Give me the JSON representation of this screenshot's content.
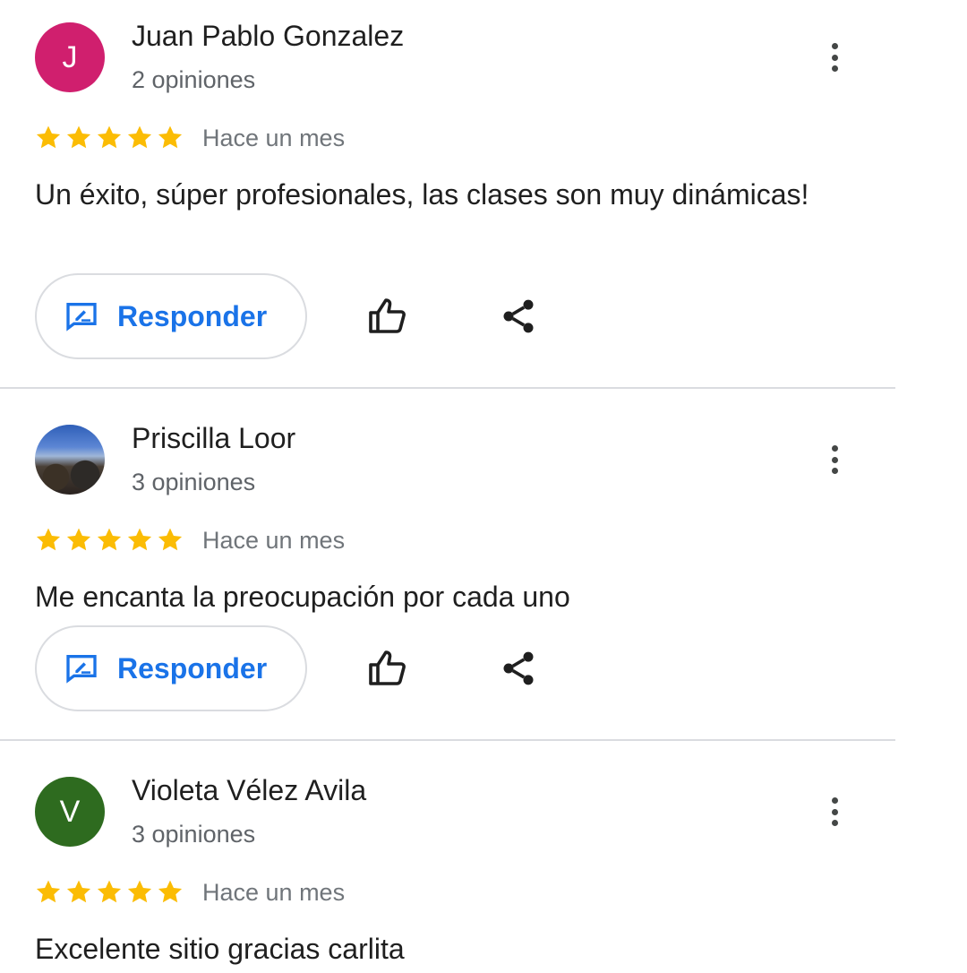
{
  "reviews": [
    {
      "avatar_letter": "J",
      "avatar_color": "#d01f6e",
      "name": "Juan Pablo Gonzalez",
      "review_count": "2 opiniones",
      "stars": 5,
      "date": "Hace un mes",
      "text": "Un éxito, súper profesionales, las clases son muy dinámicas!",
      "reply_label": "Responder"
    },
    {
      "avatar_letter": "",
      "avatar_color": "",
      "name": "Priscilla Loor",
      "review_count": "3 opiniones",
      "stars": 5,
      "date": "Hace un mes",
      "text": "Me encanta la preocupación por cada uno",
      "reply_label": "Responder"
    },
    {
      "avatar_letter": "V",
      "avatar_color": "#2e6b1f",
      "name": "Violeta Vélez Avila",
      "review_count": "3 opiniones",
      "stars": 5,
      "date": "Hace un mes",
      "text": "Excelente sitio gracias carlita",
      "reply_label": "Responder"
    }
  ],
  "icons": {
    "more": "more-vert-icon",
    "reply": "reply-review-icon",
    "like": "thumb-up-icon",
    "share": "share-icon"
  },
  "colors": {
    "star": "#fbbc04",
    "accent": "#1a73e8",
    "secondary_text": "#5f6368"
  }
}
